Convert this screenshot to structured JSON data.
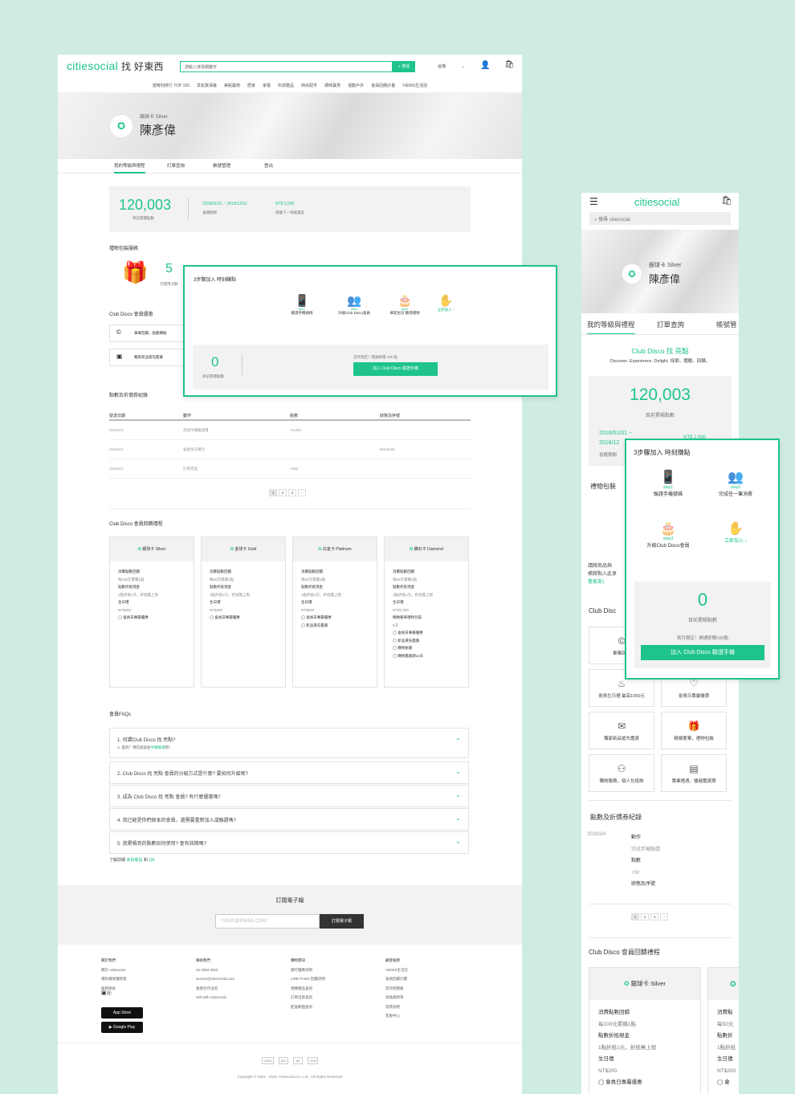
{
  "colors": {
    "accent": "#1ec48a",
    "bg": "#cfece3"
  },
  "desk": {
    "logo": "citiesocial",
    "logo_sub": "找 好東西",
    "search_placeholder": "請輸入搜尋關鍵字",
    "search_btn": "搜尋",
    "region": "台灣",
    "nav": [
      "當時刻排行 TOP 100",
      "享氣質保養",
      "美點藝術",
      "居家",
      "家電",
      "科技酷品",
      "時尚配件",
      "媽咪寶貝",
      "運動戶外",
      "會員回饋計畫",
      "VIEWS生活誌"
    ],
    "card_type": "銀球卡 Silver",
    "user": "陳彥偉",
    "tabs": [
      "我的等級與禮程",
      "訂單查詢",
      "帳號管理",
      "登出"
    ],
    "points": "120,003",
    "points_label": "目前累積點數",
    "period": "2018/01/01 ~ 2018/12/31",
    "period_label": "會籍期間",
    "next": "NT$ 2,000",
    "next_label": "距離下一等級還差",
    "gift_title": "禮物包裝服務",
    "gift_count": "5",
    "gift_label": "可使用次數",
    "club_title": "Club Disco 會員優惠",
    "club_items": [
      "筆筆回饋，點數轉點",
      "獨家新品搶先鑑賞"
    ],
    "rec_title": "點數及折價券紀錄",
    "rec_headers": [
      "發送日期",
      "動作",
      "點數",
      "狀態及序號"
    ],
    "rec_rows": [
      [
        "2019/2/3",
        "完成手機驗證禮",
        "+5,000",
        "-"
      ],
      [
        "2019/2/3",
        "會員生日禮包",
        "-",
        "bmb3405"
      ],
      [
        "2019/2/3",
        "訂單完成",
        "+500",
        "-"
      ]
    ],
    "pages": [
      "1",
      "2",
      "3",
      "›"
    ],
    "tier_title": "Club Disco 會員回饋禮程",
    "tiers": [
      {
        "name": "銀球卡 Silver",
        "lines": [
          "消費點數回饋",
          "每100元累積1點",
          "點數折抵現金",
          "1點折抵1元，折抵無上限",
          "生日禮",
          "NT$250",
          "◯ 會員日專屬優惠"
        ]
      },
      {
        "name": "金球卡 Gold",
        "lines": [
          "消費點數回饋",
          "每50元累積1點",
          "點數折抵現金",
          "1點折抵1元，折抵無上限",
          "生日禮",
          "NT$200",
          "◯ 會員日專屬優惠"
        ]
      },
      {
        "name": "白金卡 Platinum",
        "lines": [
          "消費點數回饋",
          "每50元累積1點",
          "點數折抵現金",
          "1點折抵1元，折抵無上限",
          "生日禮",
          "NT$500",
          "◯ 會員日專屬優惠",
          "◯ 新品搶先鑑賞"
        ]
      },
      {
        "name": "鑽石卡 Diamond",
        "lines": [
          "消費點數回饋",
          "每50元累積1點",
          "點數折抵現金",
          "1點折抵1元，折抵無上限",
          "生日禮",
          "NT$1,000",
          "精緻奢華禮物包裝",
          "5次",
          "◯ 會員日專屬優惠",
          "◯ 新品搶先鑑賞",
          "◯ 購物秘書",
          "◯ 購物鑑賞期14天"
        ]
      }
    ],
    "faq_title": "會員FAQs",
    "faqs": [
      "1. 何謂Club Disco 找 亮點?",
      "2. Club Disco 找 亮點 會員的分級方式是什麼? 要如何升級呢?",
      "3. 成為 Club Disco 找 亮點 會員? 有什麼優惠嗎?",
      "4. 我已經是你們原本的會員，還需要重新加入或驗證嗎?",
      "5. 我累積到的點數如何使用? 會有效期嗎?"
    ],
    "faq1_ans": "A. 是的！現在就前往",
    "faq1_link": "手機驗證",
    "faq1_tail": "吧！",
    "more": "了解詳細",
    "more_l1": "會員權益",
    "more_and": "和",
    "more_l2": "QA",
    "sub_title": "訂閱電子報",
    "email_ph": "YOUR@EMAIL.COM",
    "sub_btn": "訂閱電子報",
    "fcols": [
      {
        "h": "關於我們",
        "items": [
          "關於 citiesocial",
          "隱私權保護政策",
          "服務條款"
        ]
      },
      {
        "h": "聯絡我們",
        "items": [
          "02 2393 2810",
          "service@citiesocial.com",
          "業務合作洽詢",
          "Sell with citiesocial"
        ]
      },
      {
        "h": "購物需知",
        "items": [
          "銀行優惠說明",
          "LINE Points 回饋說明",
          "預購禮品查詢",
          "訂單出貨查詢",
          "配送範圍查詢"
        ]
      },
      {
        "h": "顧客服務",
        "items": [
          "VIEWS生活誌",
          "會員回饋計畫",
          "常見問題集",
          "退換貨政策",
          "發票說明",
          "客服中心"
        ]
      }
    ],
    "app1": "App Store",
    "app2": "Google Play",
    "pay": [
      "VISA",
      "MC",
      "AE",
      "JCB"
    ],
    "copyright": "Copyright © 2001 - 2018. Citiesocial Co. Ltd., All Rights Reserved"
  },
  "popup1": {
    "title": "3步驟加入 時刻賺點",
    "steps": [
      {
        "s": "step1",
        "t": "驗證手機號碼"
      },
      {
        "s": "step2",
        "t": "升級Club Disco會員"
      },
      {
        "s": "step3",
        "t": "填寫生日 獲得禮物"
      },
      {
        "s": "",
        "t": "立即加入 ›"
      }
    ],
    "zero": "0",
    "zero_label": "目前累積點數",
    "promo": "首月限定！開通即贈 100 點",
    "btn": "加入 Club Disco 驗證手機"
  },
  "mob": {
    "logo": "citiesocial",
    "search": "搜尋 citiesocial",
    "card_type": "銀球卡 Silver",
    "user": "陳彥偉",
    "tabs": [
      "我的等級與禮程",
      "訂單查詢",
      "帳號管"
    ],
    "club": "Club Disco 找 亮點",
    "club_sub": "Discover. Experience. Delight. 探索。體驗。回饋。",
    "points": "120,003",
    "points_label": "目前累積點數",
    "period": "2018/01/01 ~",
    "period2": "2018/12",
    "period_label": "會籍期間",
    "next": "NT$ 2,000",
    "gift": "禮物包裝",
    "note1": "請將商品與",
    "note2": "帳將點入此享",
    "note3": "驚客架)",
    "club_disc": "Club Disc",
    "grid": [
      {
        "i": "©",
        "t": "筆筆回饋"
      },
      {
        "i": "",
        "t": ""
      },
      {
        "i": "♨",
        "t": "會員生日禮 最高1000元"
      },
      {
        "i": "♡",
        "t": "會員日專屬優惠"
      },
      {
        "i": "✉",
        "t": "獨家新品搶先鑑賞"
      },
      {
        "i": "🎁",
        "t": "精緻奢華，禮物包裝"
      },
      {
        "i": "⚇",
        "t": "購物服務，個人化諮詢"
      },
      {
        "i": "▤",
        "t": "專業禮遇，優越鑑賞期"
      }
    ],
    "rec": "點數及折價券紀錄",
    "rdate": "2019/3/4",
    "ract": "動作",
    "ract_v": "完成手機驗證",
    "rpts": "點數",
    "rpts_v": "+50",
    "rstat": "狀態及序號",
    "rstat_v": "-",
    "pages": [
      "1",
      "2",
      "3",
      "›"
    ],
    "tier": "Club Disco 會員回饋禮程",
    "tcard": {
      "name": "銀球卡 Silver",
      "l": [
        "消費點數回饋",
        "每100元累積1點",
        "點數折抵現金",
        "1點折抵1元，折抵無上限",
        "生日禮",
        "NT$200",
        "◯ 會員日專屬優惠"
      ]
    },
    "tcard2": [
      "消費點",
      "每50元",
      "點數折",
      "1點折抵",
      "生日禮",
      "NT$200",
      "◯ 會"
    ]
  },
  "popup2": {
    "title": "3步驟加入 時刻賺點",
    "steps": [
      {
        "s": "step1",
        "t": "驗證手機號碼"
      },
      {
        "s": "step2",
        "t": "完成任一筆消費"
      },
      {
        "s": "step3",
        "t": "升級Club Disco會員"
      },
      {
        "s": "",
        "t": "立即加入 ›"
      }
    ],
    "zero": "0",
    "zero_label": "目前累積點數",
    "promo": "首月限定！開通即贈100點",
    "btn": "加入 Club Disco 驗證手機"
  }
}
